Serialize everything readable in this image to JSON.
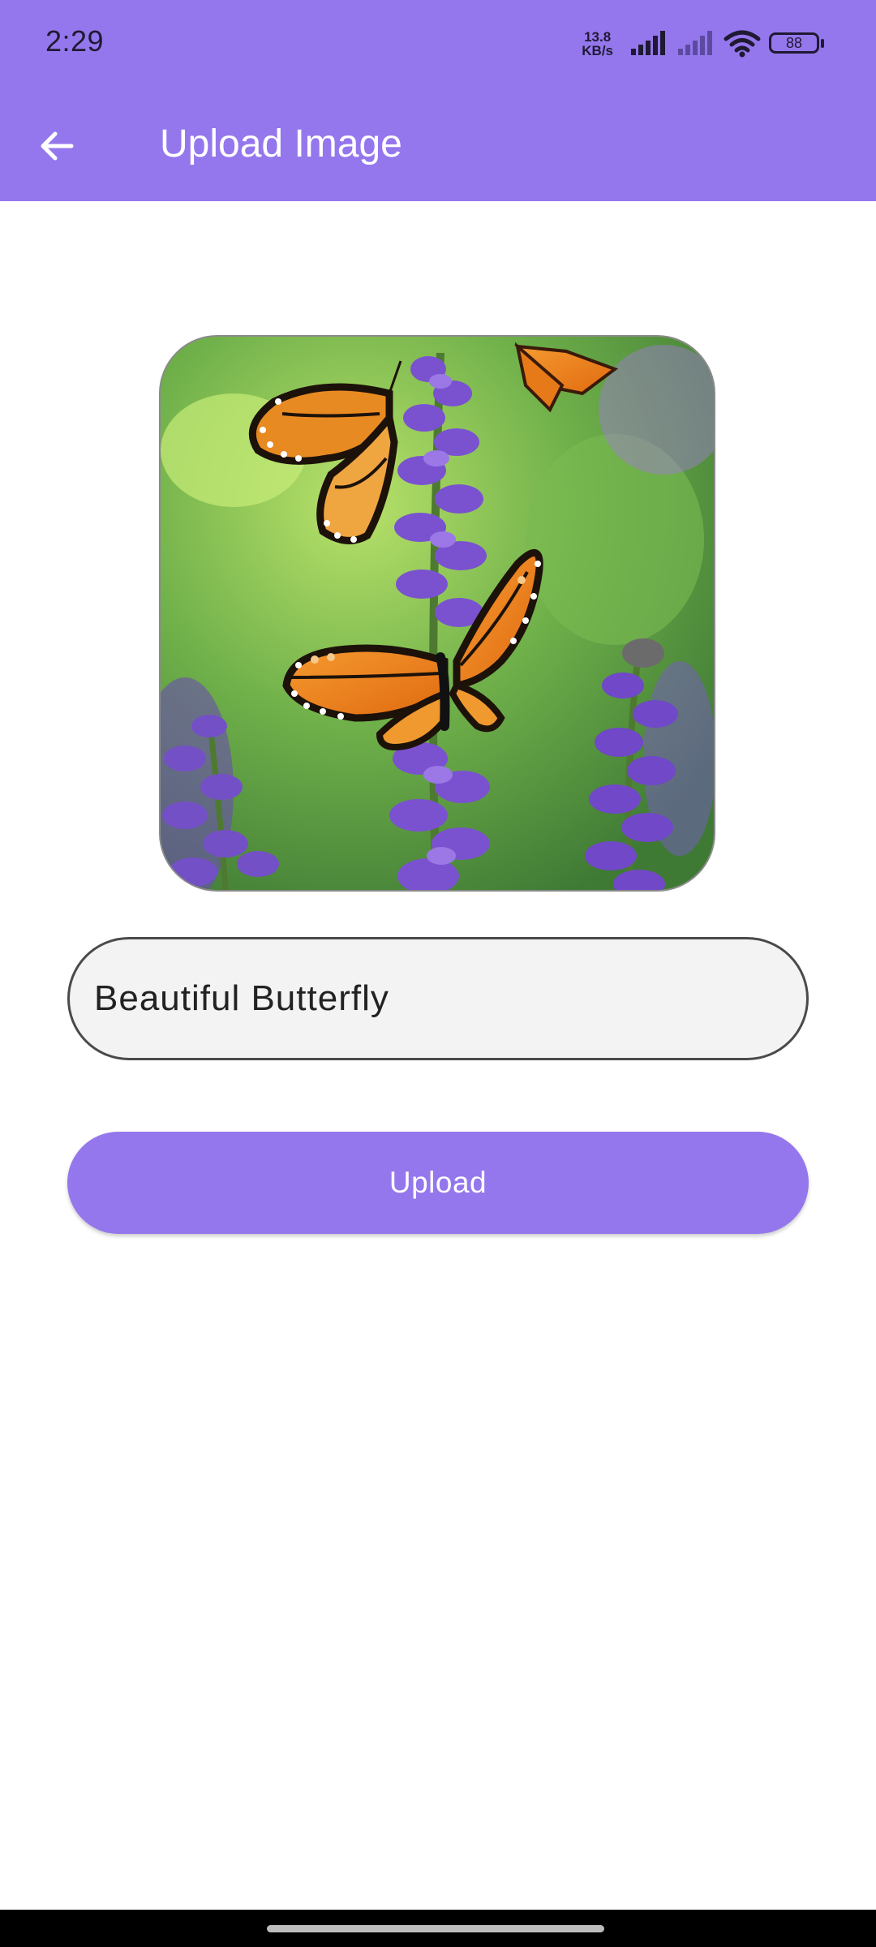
{
  "status_bar": {
    "time": "2:29",
    "net_speed_value": "13.8",
    "net_speed_unit": "KB/s",
    "battery": "88",
    "icons": [
      "signal-bars-icon",
      "signal-bars-icon",
      "wifi-icon",
      "battery-icon"
    ]
  },
  "app_bar": {
    "back_icon": "arrow-left-icon",
    "title": "Upload Image"
  },
  "preview": {
    "description_icon": "selected-photo"
  },
  "caption_field": {
    "value": "Beautiful Butterfly"
  },
  "upload_button": {
    "label": "Upload"
  },
  "colors": {
    "primary": "#9577ed",
    "field_background": "#f3f3f3",
    "nav_bar": "#000000"
  }
}
